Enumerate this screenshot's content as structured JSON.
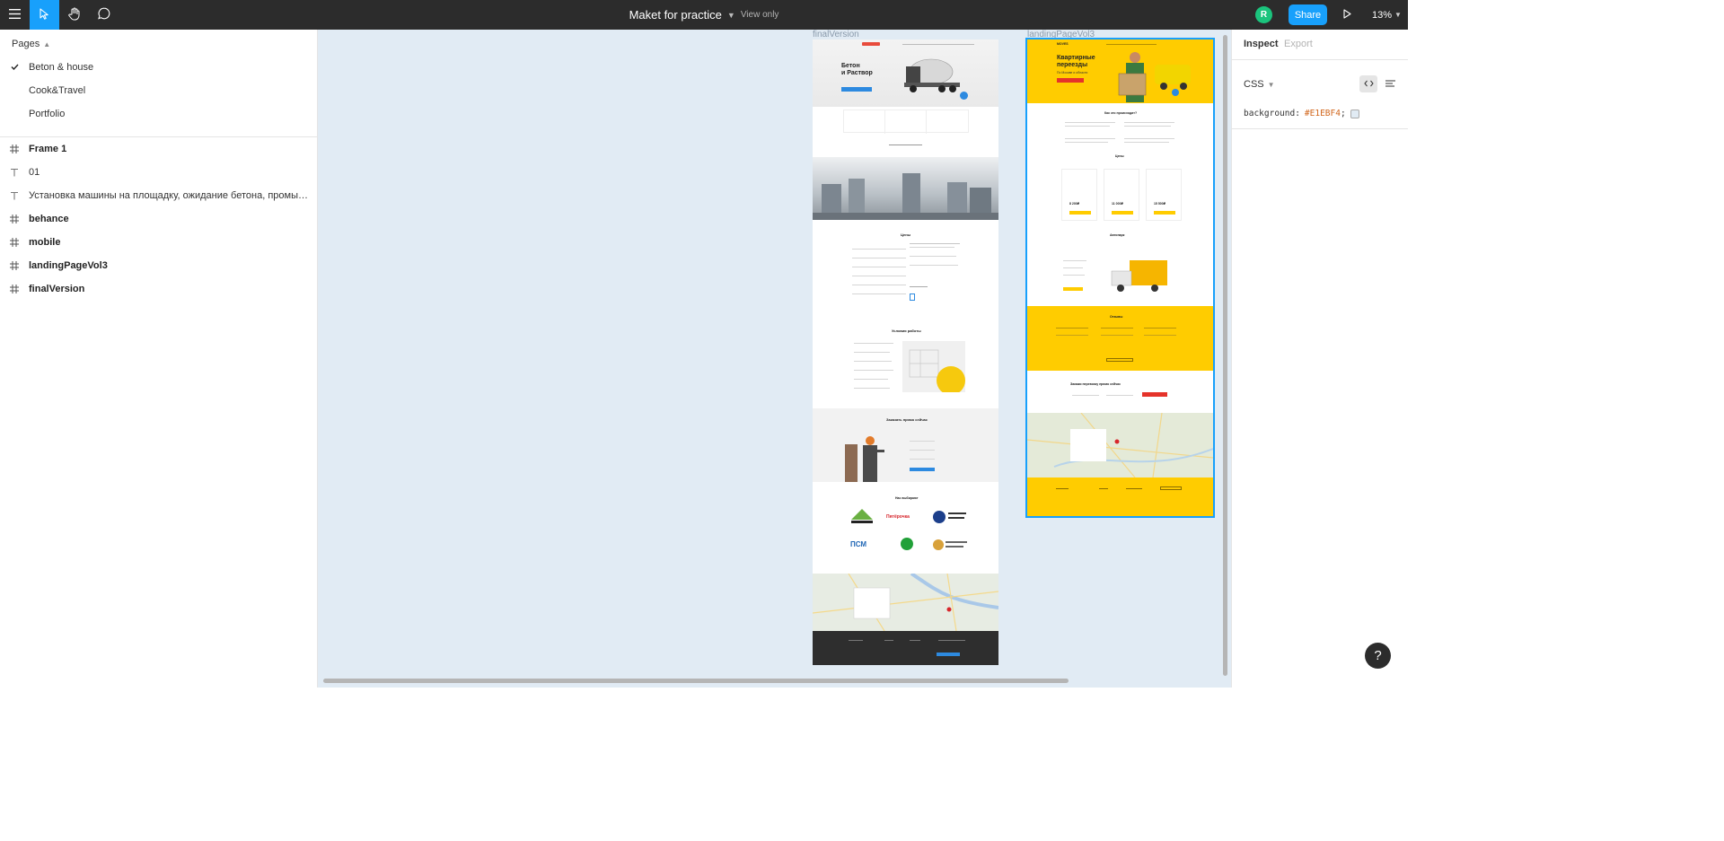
{
  "topbar": {
    "title": "Maket for practice",
    "view_mode": "View only",
    "avatar_initial": "R",
    "share_label": "Share",
    "zoom": "13%"
  },
  "pages": {
    "header": "Pages",
    "items": [
      {
        "label": "Beton & house",
        "selected": true
      },
      {
        "label": "Cook&Travel",
        "selected": false
      },
      {
        "label": "Portfolio",
        "selected": false
      }
    ]
  },
  "layers": [
    {
      "label": "Frame 1",
      "type": "frame"
    },
    {
      "label": "01",
      "type": "text"
    },
    {
      "label": "Установка машины на площадку, ожидание бетона, промывка после...",
      "type": "text"
    },
    {
      "label": "behance",
      "type": "frame"
    },
    {
      "label": "mobile",
      "type": "frame"
    },
    {
      "label": "landingPageVol3",
      "type": "frame"
    },
    {
      "label": "finalVersion",
      "type": "frame"
    }
  ],
  "canvas": {
    "background": "#E1EBF4",
    "frames": {
      "final": {
        "label": "finalVersion",
        "hero_title_1": "Бетон",
        "hero_title_2": "и Раствор",
        "section_prices": "Цены",
        "section_conditions": "Условия работы",
        "section_order": "Заказать прямо сейчас",
        "section_clients": "Нас выбирают",
        "client_logos": [
          "ЛЕРУА МЕРЛЕН",
          "Пятёрочка",
          "ЯРОСЛАВСКИЙ ШИННЫЙ ЗАВОД",
          "ПСМ",
          "Сбербанк",
          "Ярославский зоопарк"
        ]
      },
      "landing": {
        "label": "landingPageVol3",
        "brand": "MOVES",
        "hero_title_1": "Квартирные",
        "hero_title_2": "переезды",
        "hero_sub": "По Москве и области",
        "section_how": "Как это происходит?",
        "section_prices": "Цены",
        "section_park": "Автопарк",
        "section_reviews": "Отзывы",
        "section_order": "Закажи перевозку прямо сейчас",
        "price_values": [
          "8 200₽",
          "11 000₽",
          "15 500₽"
        ],
        "accent": "#FFCC00"
      }
    }
  },
  "inspect": {
    "tab_inspect": "Inspect",
    "tab_export": "Export",
    "code_lang": "CSS",
    "css_property": "background:",
    "css_value": "#E1EBF4",
    "css_semicolon": ";"
  },
  "help_label": "?"
}
